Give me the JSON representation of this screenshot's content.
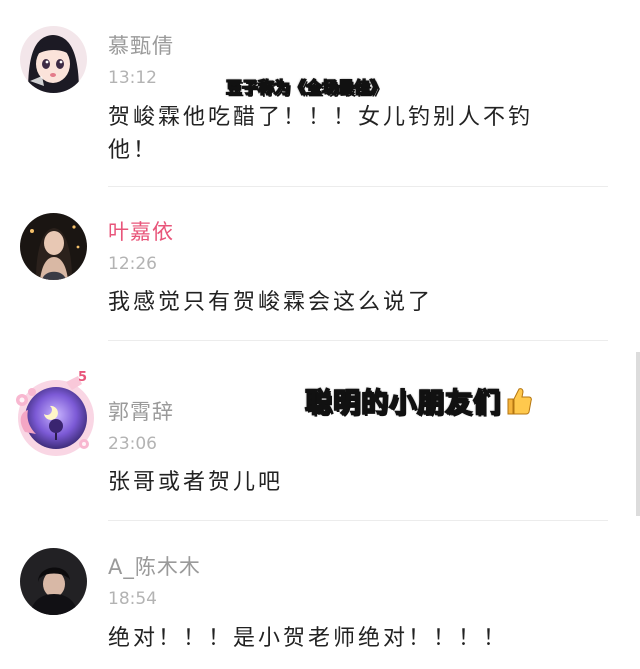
{
  "captions": {
    "top": "豆子称为《全场最佳》",
    "middle": "聪明的小朋友们"
  },
  "comments": [
    {
      "username": "慕甄倩",
      "time": "13:12",
      "content": "贺峻霖他吃醋了！！！女儿钓别人不钓他！"
    },
    {
      "username": "叶嘉依",
      "time": "12:26",
      "content": "我感觉只有贺峻霖会这么说了"
    },
    {
      "username": "郭霄辞",
      "time": "23:06",
      "content": "张哥或者贺儿吧",
      "badge": "5"
    },
    {
      "username": "A_陈木木",
      "time": "18:54",
      "content": "绝对！！！是小贺老师绝对！！！！"
    }
  ],
  "colors": {
    "username": "#9a9a9a",
    "username_highlight": "#e8557a",
    "time": "#b3b3b3",
    "content": "#222222"
  },
  "icons": {
    "thumbs_up": "thumbs-up-emoji-icon"
  }
}
